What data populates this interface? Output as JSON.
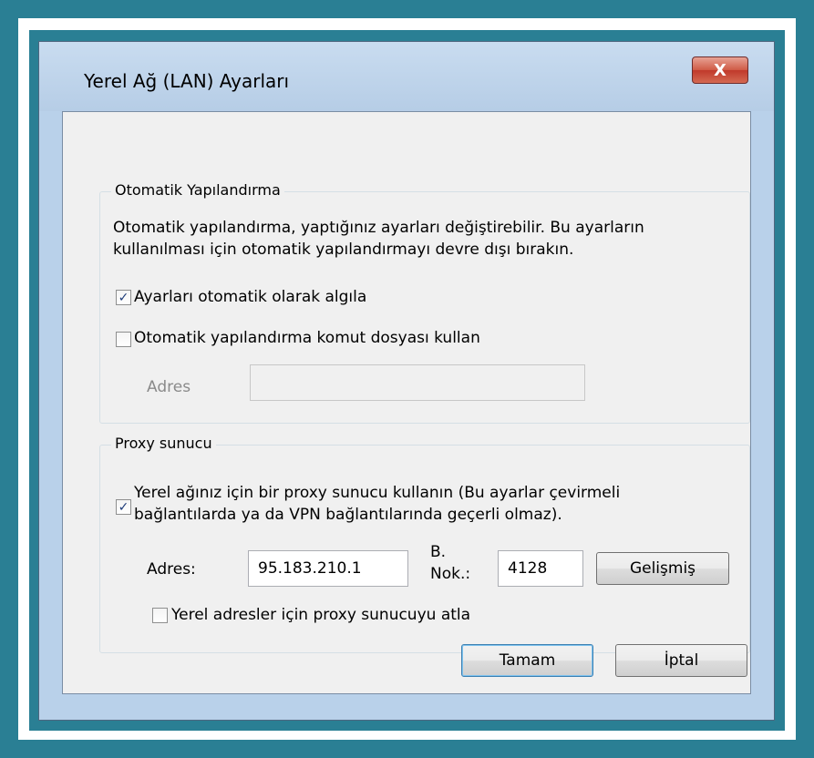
{
  "window": {
    "title": "Yerel Ağ (LAN) Ayarları",
    "close_glyph": "X"
  },
  "auto_config": {
    "legend": "Otomatik Yapılandırma",
    "description_line1": "Otomatik yapılandırma, yaptığınız ayarları değiştirebilir. Bu ayarların",
    "description_line2": "kullanılması için otomatik yapılandırmayı devre dışı bırakın.",
    "detect_label": "Ayarları otomatik olarak algıla",
    "detect_checked": true,
    "script_label": "Otomatik yapılandırma komut dosyası kullan",
    "script_checked": false,
    "address_label": "Adres",
    "address_value": ""
  },
  "proxy": {
    "legend": "Proxy sunucu",
    "use_proxy_line1": "Yerel ağınız için bir proxy sunucu kullanın (Bu ayarlar çevirmeli",
    "use_proxy_line2": "bağlantılarda ya da VPN bağlantılarında geçerli olmaz).",
    "use_proxy_checked": true,
    "address_label": "Adres:",
    "address_value": "95.183.210.1",
    "port_label_line1": "B.",
    "port_label_line2": "Nok.:",
    "port_value": "4128",
    "advanced_label": "Gelişmiş",
    "bypass_label": "Yerel adresler için proxy sunucuyu atla",
    "bypass_checked": false
  },
  "buttons": {
    "ok": "Tamam",
    "cancel": "İptal"
  },
  "icons": {
    "check_glyph": "✓"
  }
}
